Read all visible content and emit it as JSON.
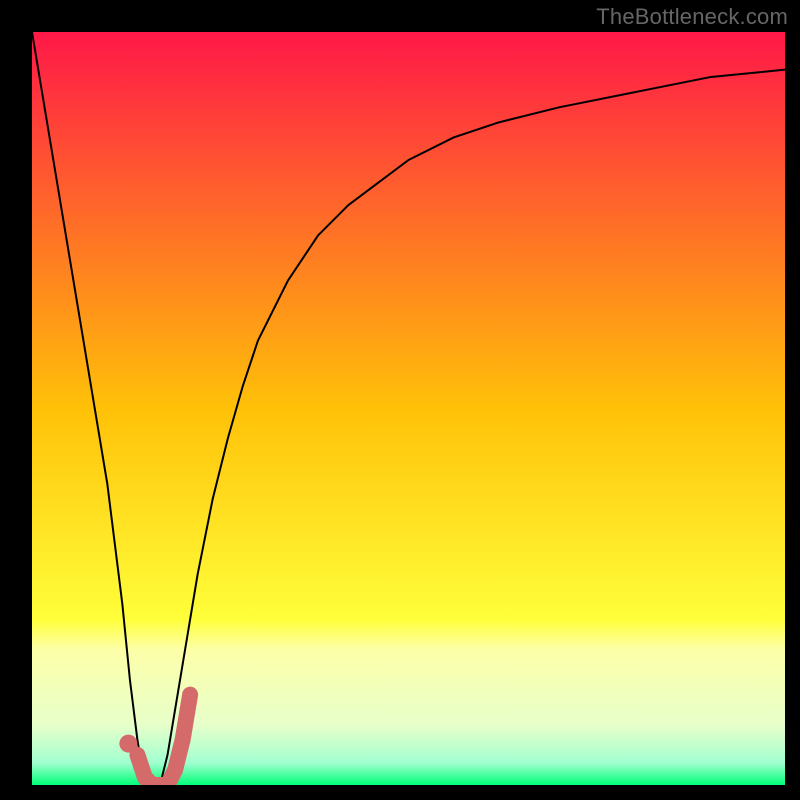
{
  "watermark": "TheBottleneck.com",
  "chart_data": {
    "type": "line",
    "title": "",
    "xlabel": "",
    "ylabel": "",
    "xlim": [
      0,
      100
    ],
    "ylim": [
      0,
      100
    ],
    "axes_visible": false,
    "grid": false,
    "background_gradient": {
      "stops": [
        {
          "pos": 0.0,
          "color": "#ff1848"
        },
        {
          "pos": 0.5,
          "color": "#ffc108"
        },
        {
          "pos": 0.78,
          "color": "#ffff3a"
        },
        {
          "pos": 0.82,
          "color": "#fdffa8"
        },
        {
          "pos": 0.92,
          "color": "#e7ffca"
        },
        {
          "pos": 0.97,
          "color": "#a3ffd0"
        },
        {
          "pos": 1.0,
          "color": "#00ff78"
        }
      ]
    },
    "series": [
      {
        "name": "bottleneck-curve",
        "type": "line",
        "color": "#000000",
        "width": 2,
        "x": [
          0,
          2,
          4,
          6,
          8,
          10,
          12,
          13,
          14,
          15,
          16,
          17,
          18,
          19,
          20,
          22,
          24,
          26,
          28,
          30,
          34,
          38,
          42,
          46,
          50,
          56,
          62,
          70,
          80,
          90,
          100
        ],
        "y": [
          100,
          88,
          76,
          64,
          52,
          40,
          24,
          14,
          6,
          0,
          0,
          0,
          4,
          10,
          16,
          28,
          38,
          46,
          53,
          59,
          67,
          73,
          77,
          80,
          83,
          86,
          88,
          90,
          92,
          94,
          95
        ]
      },
      {
        "name": "highlight-j",
        "type": "line",
        "color": "#d46a6a",
        "width": 16,
        "linecap": "round",
        "x": [
          14,
          15,
          16,
          17,
          18,
          19,
          20,
          21
        ],
        "y": [
          4,
          1,
          0,
          0,
          0,
          2,
          6,
          12
        ]
      }
    ],
    "markers": [
      {
        "name": "highlight-dot",
        "shape": "circle",
        "color": "#d46a6a",
        "x": 12.8,
        "y": 5.5,
        "r": 9
      }
    ]
  }
}
